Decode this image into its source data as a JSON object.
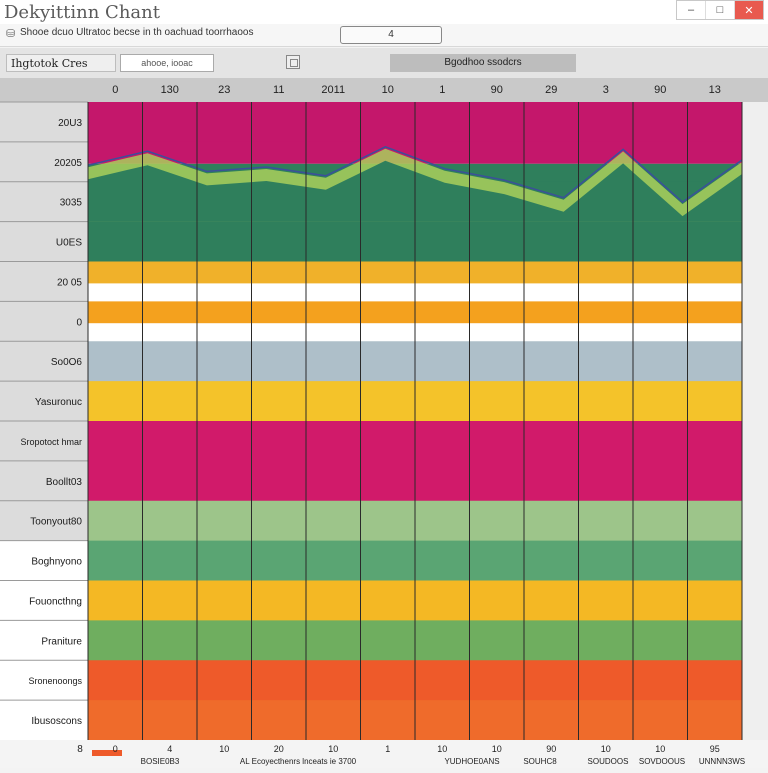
{
  "window": {
    "title": "Dekyittinn Chant",
    "controls": [
      "–",
      "□",
      "✕"
    ]
  },
  "subtitle_bar": {
    "icon": "database-icon",
    "text": "Shooe dcuo  Ultratoc becse in th oachuad  toorrhaoos",
    "center_field": "4"
  },
  "toolbar": {
    "label": "Ihgtotok Cres",
    "field": "ahooe,  iooac",
    "status": "Bgodhoo ssodcrs"
  },
  "chart_data": {
    "type": "heatmap",
    "title": "Dekyittinn Chant",
    "top_ticks": [
      "0",
      "130",
      "23",
      "11",
      "2011",
      "10",
      "1",
      "90",
      "29",
      "3",
      "90",
      "13"
    ],
    "columns": 12,
    "rows": [
      {
        "label": "20U3",
        "colors": [
          "#c4176b"
        ]
      },
      {
        "label": "20205",
        "colors": [
          "#c4176b",
          "#2f7f5c"
        ]
      },
      {
        "label": "3035",
        "colors": [
          "#2f7f5c"
        ]
      },
      {
        "label": "U0ES",
        "colors": [
          "#2f7f5c"
        ]
      },
      {
        "label": "20 05",
        "colors": [
          "#f0b12a",
          "#ffffff"
        ]
      },
      {
        "label": "0",
        "colors": [
          "#f4a11e",
          "#ffffff"
        ]
      },
      {
        "label": "So0O6",
        "colors": [
          "#aebfc9"
        ]
      },
      {
        "label": "Yasuronuc",
        "colors": [
          "#f4c32a"
        ]
      },
      {
        "label": "Sropotoct hmar",
        "colors": [
          "#d11a6a"
        ]
      },
      {
        "label": "Boollt03",
        "colors": [
          "#d11a6a"
        ]
      },
      {
        "label": "Toonyout80",
        "colors": [
          "#9dc58a"
        ]
      },
      {
        "label": "Boghnyono",
        "colors": [
          "#5aa573"
        ]
      },
      {
        "label": "Fouoncthng",
        "colors": [
          "#f4b824"
        ]
      },
      {
        "label": "Praniture",
        "colors": [
          "#6fae5f"
        ]
      },
      {
        "label": "Sronenoongs",
        "colors": [
          "#ee5a2a"
        ]
      },
      {
        "label": "Ibusoscons",
        "colors": [
          "#ef6b2b"
        ]
      }
    ],
    "bottom_ticks": [
      "0",
      "4",
      "10",
      "20",
      "10",
      "1",
      "10",
      "10",
      "90",
      "10",
      "10",
      "95"
    ],
    "bottom_labels": [
      "BOSIE0B3",
      "AL Ecoyecthenrs  lnceats  ie 3700",
      "YUDHOE0ANS",
      "SOUHC8",
      "SOUDOOS",
      "SOVDOOUS",
      "UNNNN3WS"
    ],
    "corner_label": "8",
    "ridge_values": [
      0.62,
      0.78,
      0.55,
      0.6,
      0.5,
      0.83,
      0.58,
      0.45,
      0.25,
      0.8,
      0.2,
      0.68
    ],
    "grid": true
  }
}
